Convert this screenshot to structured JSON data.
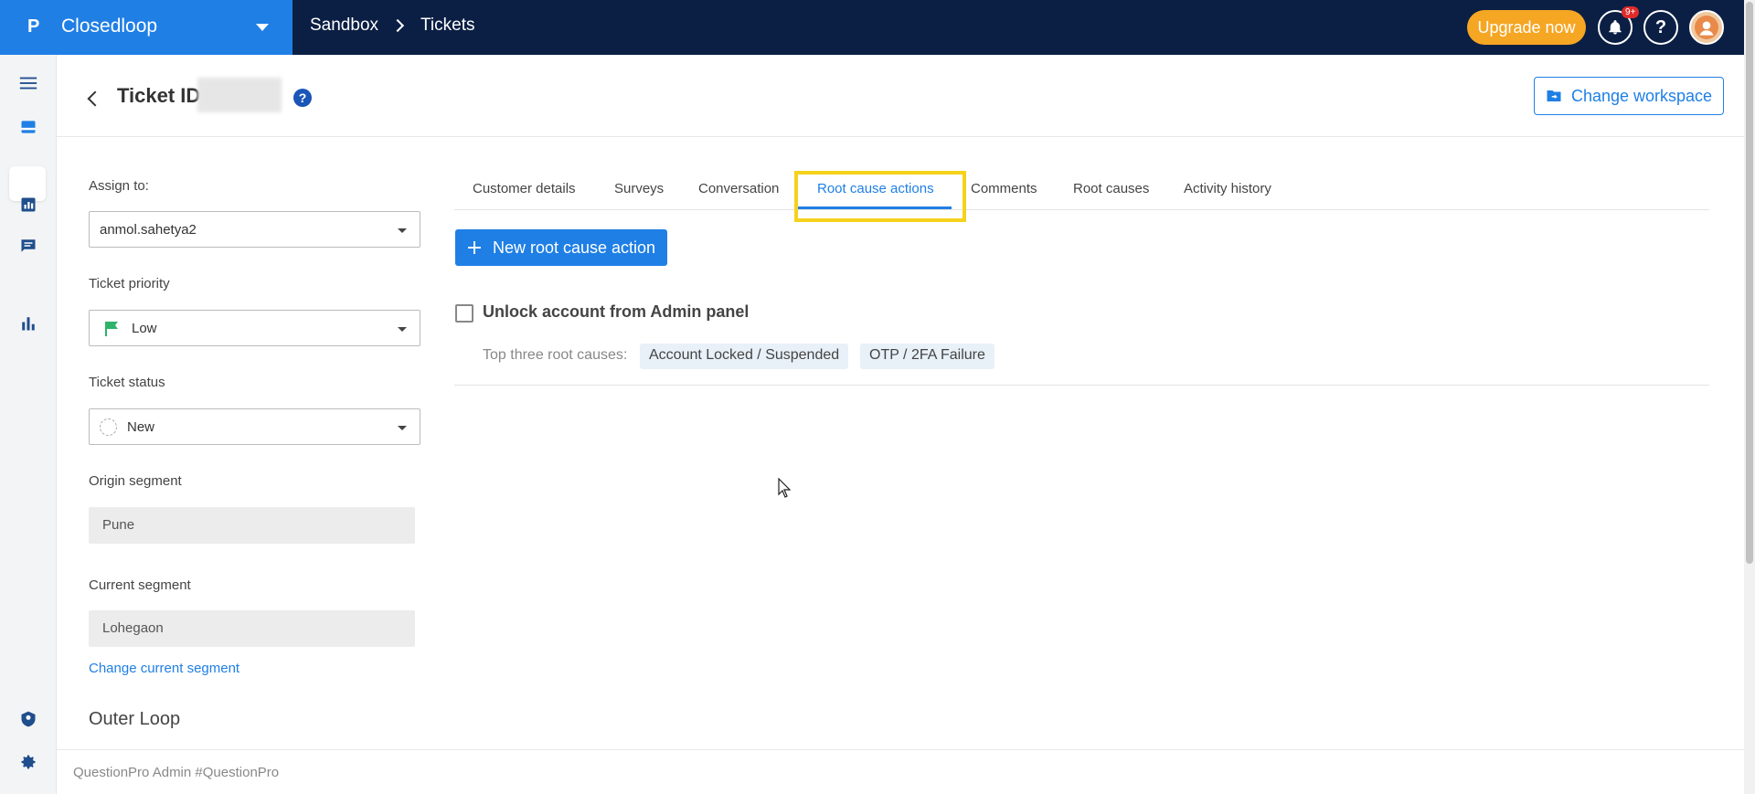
{
  "topbar": {
    "brand": "Closedloop",
    "breadcrumbs": [
      "Sandbox",
      "Tickets"
    ],
    "upgrade_label": "Upgrade now",
    "notifications_badge": "9+",
    "help_label": "?"
  },
  "sidebar": {
    "items": [
      "menu-icon",
      "ticket-icon",
      "report-icon",
      "chat-icon",
      "bar-chart-icon",
      "shield-icon",
      "gear-icon"
    ]
  },
  "header": {
    "title": "Ticket ID",
    "help": "?",
    "change_workspace_label": "Change workspace"
  },
  "left_panel": {
    "assign_to_label": "Assign to:",
    "assign_to_value": "anmol.sahetya2",
    "priority_label": "Ticket priority",
    "priority_value": "Low",
    "priority_color": "#2db36a",
    "status_label": "Ticket status",
    "status_value": "New",
    "origin_segment_label": "Origin segment",
    "origin_segment_value": "Pune",
    "current_segment_label": "Current segment",
    "current_segment_value": "Lohegaon",
    "change_segment_link": "Change current segment",
    "outer_loop_title": "Outer Loop"
  },
  "tabs": [
    {
      "label": "Customer details"
    },
    {
      "label": "Surveys"
    },
    {
      "label": "Conversation"
    },
    {
      "label": "Root cause actions"
    },
    {
      "label": "Comments"
    },
    {
      "label": "Root causes"
    },
    {
      "label": "Activity history"
    }
  ],
  "active_tab": "Root cause actions",
  "main": {
    "new_action_label": "New root cause action",
    "action_title": "Unlock account from Admin panel",
    "top_root_causes_label": "Top three root causes:",
    "root_causes": [
      "Account Locked / Suspended",
      "OTP / 2FA Failure"
    ]
  },
  "footer": {
    "text": "QuestionPro Admin #QuestionPro"
  },
  "colors": {
    "brand_blue": "#1f7fe5",
    "topbar_navy": "#0b1f44",
    "upgrade_orange": "#f5a623",
    "highlight_yellow": "#f5d21b"
  }
}
